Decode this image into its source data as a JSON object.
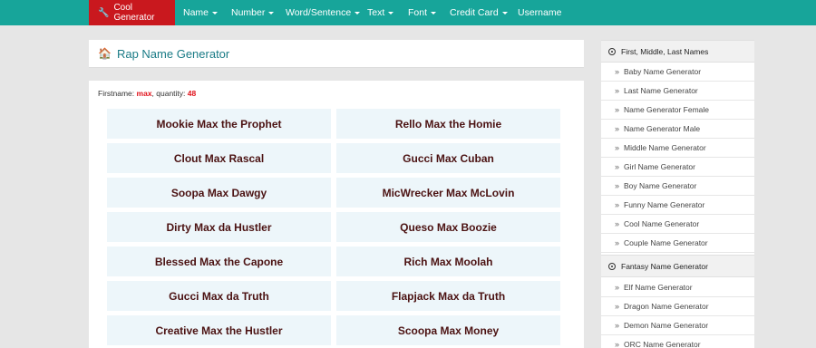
{
  "nav": {
    "brand": "Cool Generator",
    "items": [
      "Name",
      "Number",
      "Word/Sentence",
      "Text",
      "Font",
      "Credit Card",
      "Username"
    ]
  },
  "header": {
    "title": "Rap Name Generator"
  },
  "meta": {
    "firstname_label": "Firstname:",
    "firstname": "max",
    "quantity_label": ", quantity:",
    "quantity": "48"
  },
  "names": [
    "Mookie Max the Prophet",
    "Rello Max the Homie",
    "Clout Max Rascal",
    "Gucci Max Cuban",
    "Soopa Max Dawgy",
    "MicWrecker Max McLovin",
    "Dirty Max da Hustler",
    "Queso Max Boozie",
    "Blessed Max the Capone",
    "Rich Max Moolah",
    "Gucci Max da Truth",
    "Flapjack Max da Truth",
    "Creative Max the Hustler",
    "Scoopa Max Money"
  ],
  "sidebar": {
    "section1": "First, Middle, Last Names",
    "links1": [
      "Baby Name Generator",
      "Last Name Generator",
      "Name Generator Female",
      "Name Generator Male",
      "Middle Name Generator",
      "Girl Name Generator",
      "Boy Name Generator",
      "Funny Name Generator",
      "Cool Name Generator",
      "Couple Name Generator"
    ],
    "section2": "Fantasy Name Generator",
    "links2": [
      "Elf Name Generator",
      "Dragon Name Generator",
      "Demon Name Generator",
      "ORC Name Generator"
    ]
  }
}
